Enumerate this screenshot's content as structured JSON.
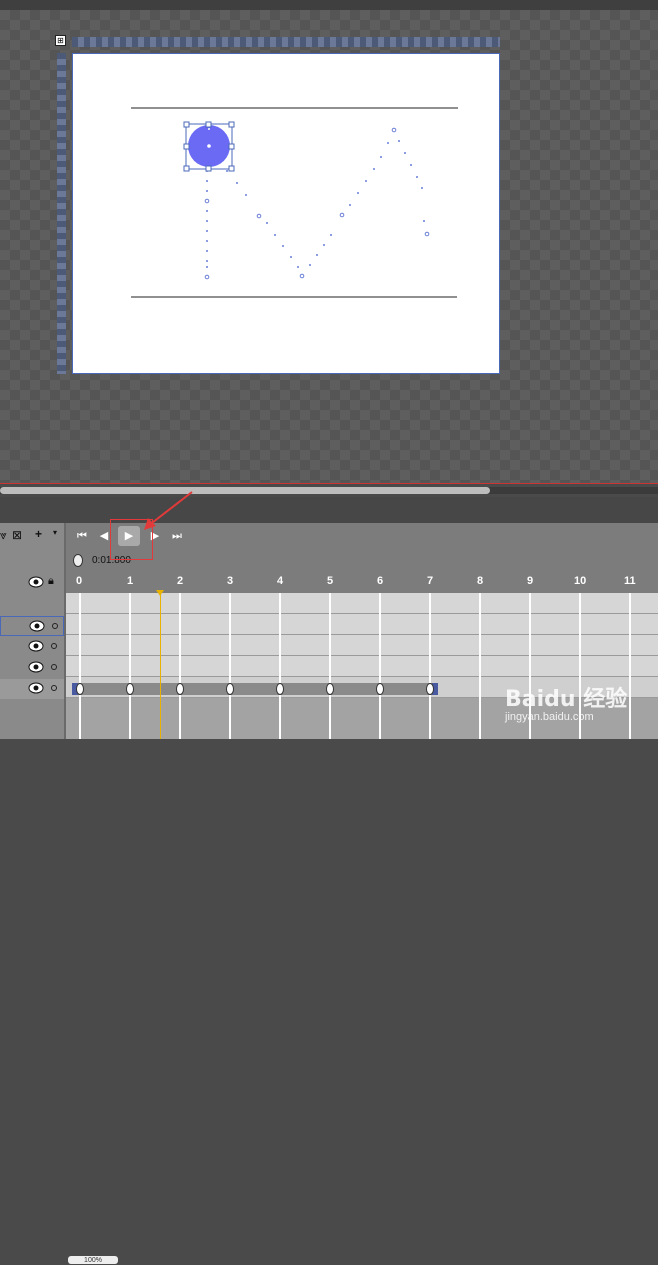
{
  "timeline": {
    "time": "0:01.800",
    "ruler_labels": [
      "0",
      "1",
      "2",
      "3",
      "4",
      "5",
      "6",
      "7",
      "8",
      "9",
      "10",
      "11"
    ],
    "playhead_seconds": 1.8,
    "keyframes_seconds": [
      0,
      1,
      2,
      3,
      4,
      5,
      6,
      7
    ],
    "zoom": "100%"
  },
  "transport": {
    "first_frame_icon": "skip-to-start-icon",
    "prev_frame_icon": "step-back-icon",
    "play_icon": "play-icon",
    "next_frame_icon": "step-forward-icon",
    "last_frame_icon": "skip-to-end-icon"
  },
  "watermark": {
    "brand": "Baidu 经验",
    "url": "jingyan.baidu.com"
  },
  "colors": {
    "accent": "#6a6af5",
    "playhead": "#e8b300",
    "annotation": "#e23a3a",
    "selection": "#4a68b8"
  }
}
